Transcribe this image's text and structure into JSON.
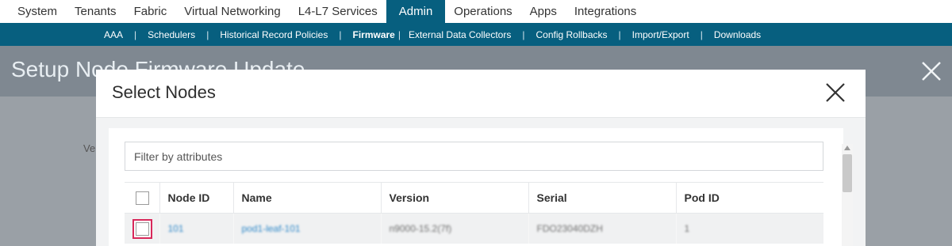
{
  "top_nav": {
    "tabs": [
      "System",
      "Tenants",
      "Fabric",
      "Virtual Networking",
      "L4-L7 Services",
      "Admin",
      "Operations",
      "Apps",
      "Integrations"
    ],
    "active": "Admin"
  },
  "sub_nav": {
    "items": [
      "AAA",
      "Schedulers",
      "Historical Record Policies",
      "Firmware",
      "External Data Collectors",
      "Config Rollbacks",
      "Import/Export",
      "Downloads"
    ],
    "active": "Firmware"
  },
  "background_page": {
    "title": "Setup Node Firmware Update",
    "partial_label": "Ve"
  },
  "modal": {
    "title": "Select Nodes",
    "filter_placeholder": "Filter by attributes",
    "columns": [
      "Node ID",
      "Name",
      "Version",
      "Serial",
      "Pod ID"
    ],
    "rows": [
      {
        "node_id": "101",
        "name": "pod1-leaf-101",
        "version": "n9000-15.2(7f)",
        "serial": "FDO23040DZH",
        "pod_id": "1"
      }
    ]
  },
  "colors": {
    "nav_accent": "#075f7f",
    "link_blue": "#2d87c8",
    "focus_ring": "#d8285a"
  }
}
